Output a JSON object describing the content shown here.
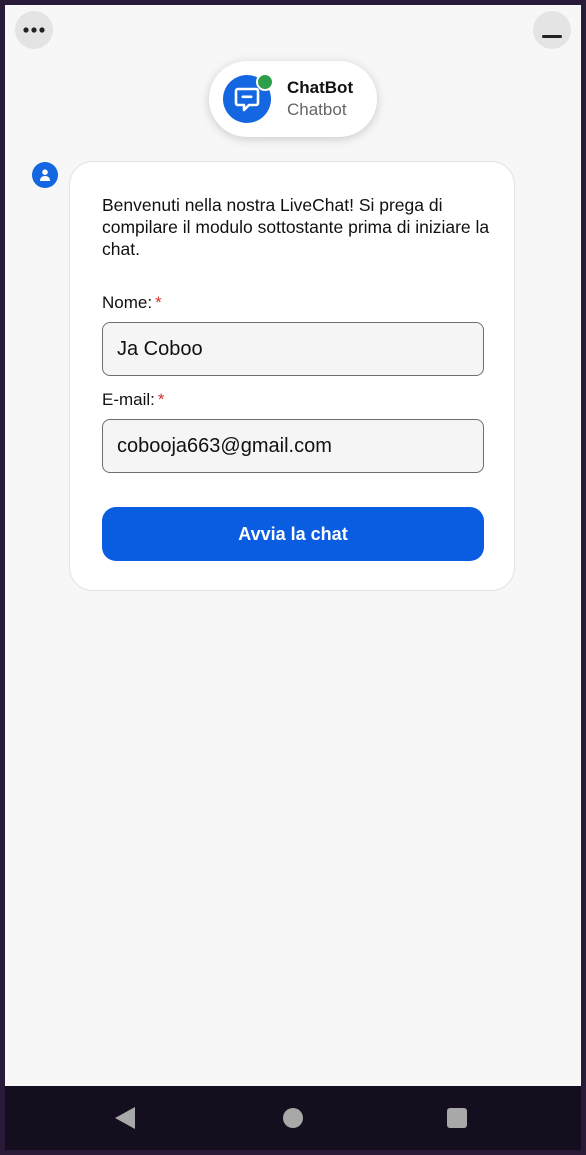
{
  "header": {
    "title": "ChatBot",
    "subtitle": "Chatbot",
    "logo_icon": "chat-bubble-icon",
    "status_color": "#2e9e4a",
    "brand_color": "#1467e0"
  },
  "controls": {
    "more_icon": "more-horizontal-icon",
    "minimize_icon": "minimize-icon"
  },
  "message": {
    "avatar_icon": "user-icon",
    "intro_text": "Benvenuti nella nostra LiveChat! Si prega di compilare il modulo sottostante prima di iniziare la chat."
  },
  "form": {
    "name_label": "Nome:",
    "name_value": "Ja Coboo",
    "email_label": "E-mail:",
    "email_value": "cobooja663@gmail.com",
    "required_mark": "*",
    "submit_label": "Avvia la chat",
    "submit_color": "#0a5ce0"
  },
  "navbar": {
    "back_icon": "back-triangle-icon",
    "home_icon": "home-circle-icon",
    "recents_icon": "recents-square-icon"
  }
}
